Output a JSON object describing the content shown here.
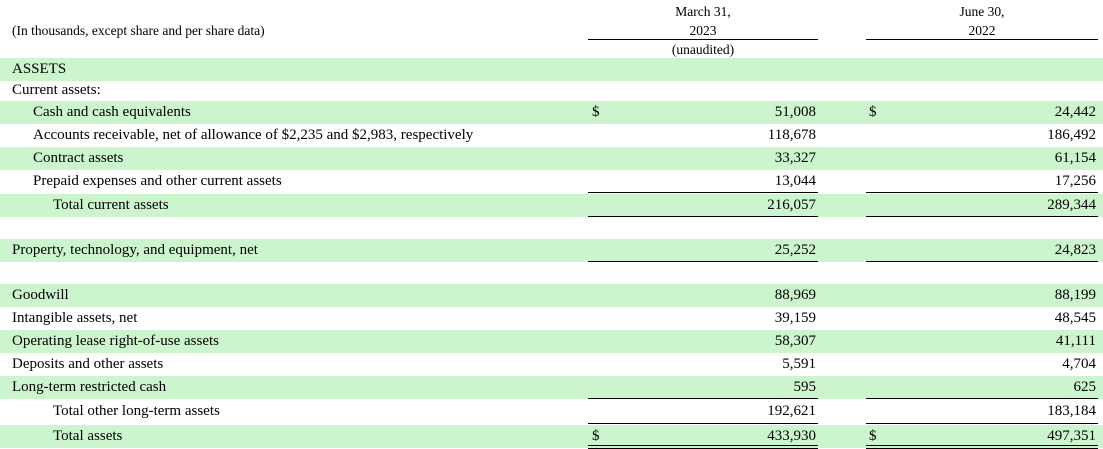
{
  "header": {
    "units": "(In thousands, except share and per share data)",
    "col1": {
      "line1": "March 31,",
      "line2": "2023",
      "line3": "(unaudited)"
    },
    "col2": {
      "line1": "June 30,",
      "line2": "2022"
    }
  },
  "rows": [
    {
      "label": "ASSETS"
    },
    {
      "label": "Current assets:"
    },
    {
      "label": "Cash and cash equivalents",
      "dollar1": "$",
      "v1": "51,008",
      "dollar2": "$",
      "v2": "24,442"
    },
    {
      "label": "Accounts receivable, net of allowance of $2,235 and $2,983, respectively",
      "v1": "118,678",
      "v2": "186,492"
    },
    {
      "label": "Contract assets",
      "v1": "33,327",
      "v2": "61,154"
    },
    {
      "label": "Prepaid expenses and other current assets",
      "v1": "13,044",
      "v2": "17,256"
    },
    {
      "label": "Total current assets",
      "v1": "216,057",
      "v2": "289,344"
    },
    {
      "label": "Property, technology, and equipment, net",
      "v1": "25,252",
      "v2": "24,823"
    },
    {
      "label": "Goodwill",
      "v1": "88,969",
      "v2": "88,199"
    },
    {
      "label": "Intangible assets, net",
      "v1": "39,159",
      "v2": "48,545"
    },
    {
      "label": "Operating lease right-of-use assets",
      "v1": "58,307",
      "v2": "41,111"
    },
    {
      "label": "Deposits and other assets",
      "v1": "5,591",
      "v2": "4,704"
    },
    {
      "label": "Long-term restricted cash",
      "v1": "595",
      "v2": "625"
    },
    {
      "label": "Total other long-term assets",
      "v1": "192,621",
      "v2": "183,184"
    },
    {
      "label": "Total assets",
      "dollar1": "$",
      "v1": "433,930",
      "dollar2": "$",
      "v2": "497,351"
    }
  ]
}
